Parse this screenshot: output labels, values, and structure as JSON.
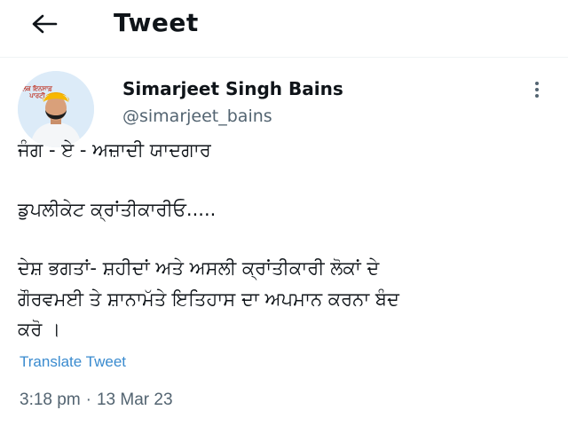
{
  "header": {
    "back_icon": "arrow-left-icon",
    "title": "Tweet"
  },
  "author": {
    "avatar_badge_text": "ਲੋਕ ਇਨਸਾਫ਼ ਪਾਰਟੀ",
    "avatar_accent": "#f2a900",
    "name": "Simarjeet Singh Bains",
    "handle": "@simarjeet_bains",
    "more_icon": "more-vertical-icon"
  },
  "tweet": {
    "lines": [
      "ਜੰਗ - ਏ - ਅਜ਼ਾਦੀ ਯਾਦਗਾਰ",
      "ਡੁਪਲੀਕੇਟ ਕ੍ਰਾਂਤੀਕਾਰੀਓ.....",
      "ਦੇਸ਼ ਭਗਤਾਂ- ਸ਼ਹੀਦਾਂ ਅਤੇ ਅਸਲੀ ਕ੍ਰਾਂਤੀਕਾਰੀ ਲੋਕਾਂ ਦੇ",
      "ਗੌਰਵਮਈ ਤੇ ਸ਼ਾਨਾਮੱਤੇ ਇਤਿਹਾਸ ਦਾ ਅਪਮਾਨ ਕਰਨਾ ਬੰਦ",
      "ਕਰੋ ।"
    ],
    "translate_label": "Translate Tweet",
    "translate_color": "#3a8bcf"
  },
  "meta": {
    "time": "3:18 pm",
    "separator": "·",
    "date": "13 Mar 23"
  }
}
